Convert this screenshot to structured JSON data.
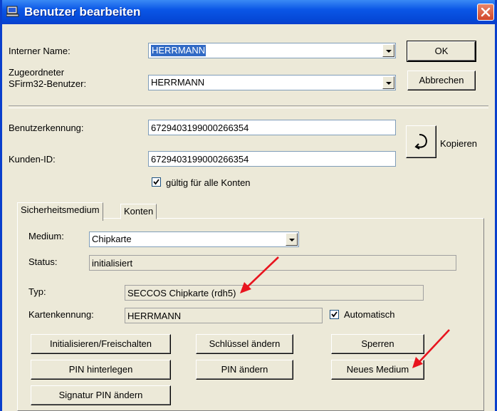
{
  "window": {
    "title": "Benutzer bearbeiten",
    "icon": "user-computer-icon",
    "close_icon": "close-icon"
  },
  "form": {
    "internal_name_label": "Interner Name:",
    "internal_name_value": "HERRMANN",
    "assigned_user_label_line1": "Zugeordneter",
    "assigned_user_label_line2": "SFirm32-Benutzer:",
    "assigned_user_value": "HERRMANN",
    "ok_label": "OK",
    "cancel_label": "Abbrechen",
    "user_id_label": "Benutzerkennung:",
    "user_id_value": "6729403199000266354",
    "customer_id_label": "Kunden-ID:",
    "customer_id_value": "6729403199000266354",
    "copy_label": "Kopieren",
    "valid_all_accounts_label": "gültig für alle Konten",
    "valid_all_accounts_checked": true
  },
  "tabs": [
    {
      "label": "Sicherheitsmedium",
      "active": true
    },
    {
      "label": "Konten",
      "active": false
    }
  ],
  "security": {
    "medium_label": "Medium:",
    "medium_value": "Chipkarte",
    "status_label": "Status:",
    "status_value": "initialisiert",
    "type_label": "Typ:",
    "type_value": "SECCOS Chipkarte (rdh5)",
    "card_id_label": "Kartenkennung:",
    "card_id_value": "HERRMANN",
    "automatic_label": "Automatisch",
    "automatic_checked": true
  },
  "buttons": {
    "init_unlock": "Initialisieren/Freischalten",
    "change_key": "Schlüssel ändern",
    "lock": "Sperren",
    "store_pin": "PIN hinterlegen",
    "change_pin": "PIN ändern",
    "new_medium": "Neues Medium",
    "change_signature_pin": "Signatur PIN ändern"
  },
  "colors": {
    "annotation_arrow": "#e8141e",
    "title_bar": "#0a56e6",
    "selection": "#316ac5"
  }
}
